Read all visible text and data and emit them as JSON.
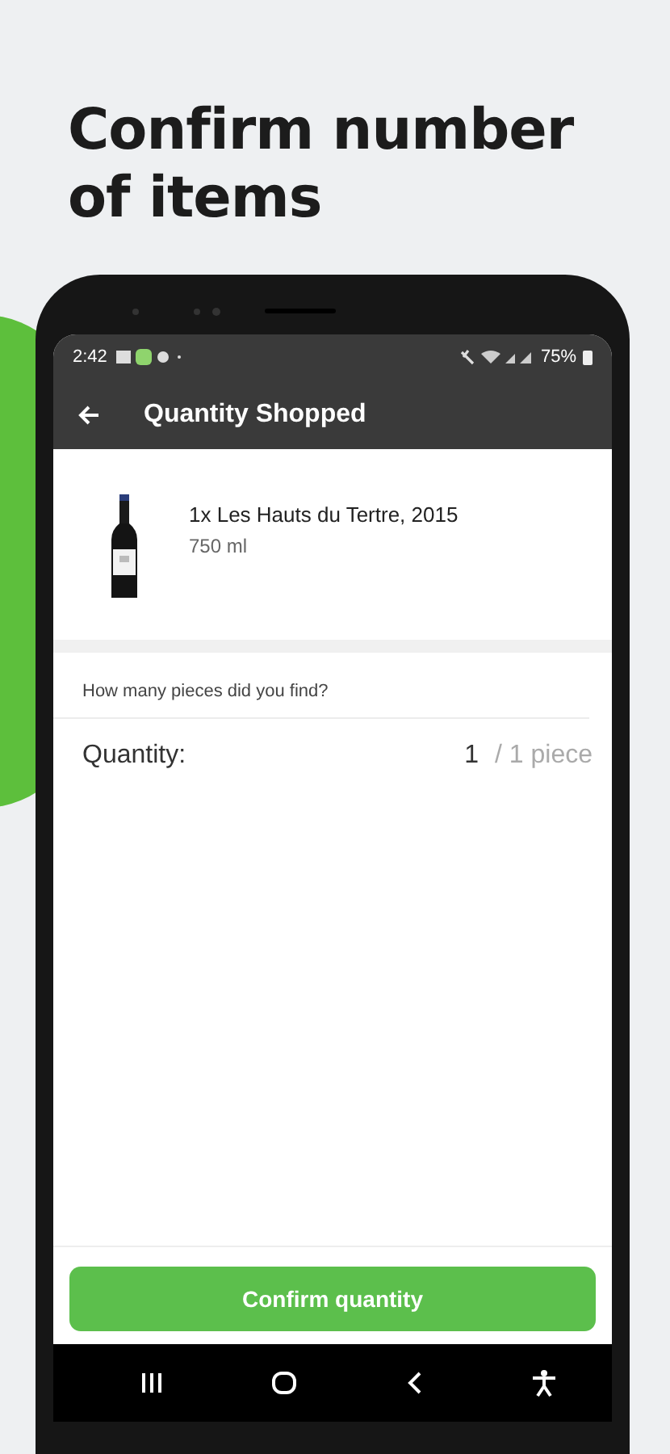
{
  "headline": "Confirm number of items",
  "status_bar": {
    "time": "2:42",
    "battery": "75%"
  },
  "app_bar": {
    "title": "Quantity Shopped"
  },
  "product": {
    "kind": "picture",
    "name": "1x Les Hauts du Tertre, 2015",
    "size": "750 ml"
  },
  "question": "How many pieces did you find?",
  "quantity": {
    "label": "Quantity:",
    "value": "1",
    "total": "/ 1 piece"
  },
  "button": "Confirm quantity"
}
